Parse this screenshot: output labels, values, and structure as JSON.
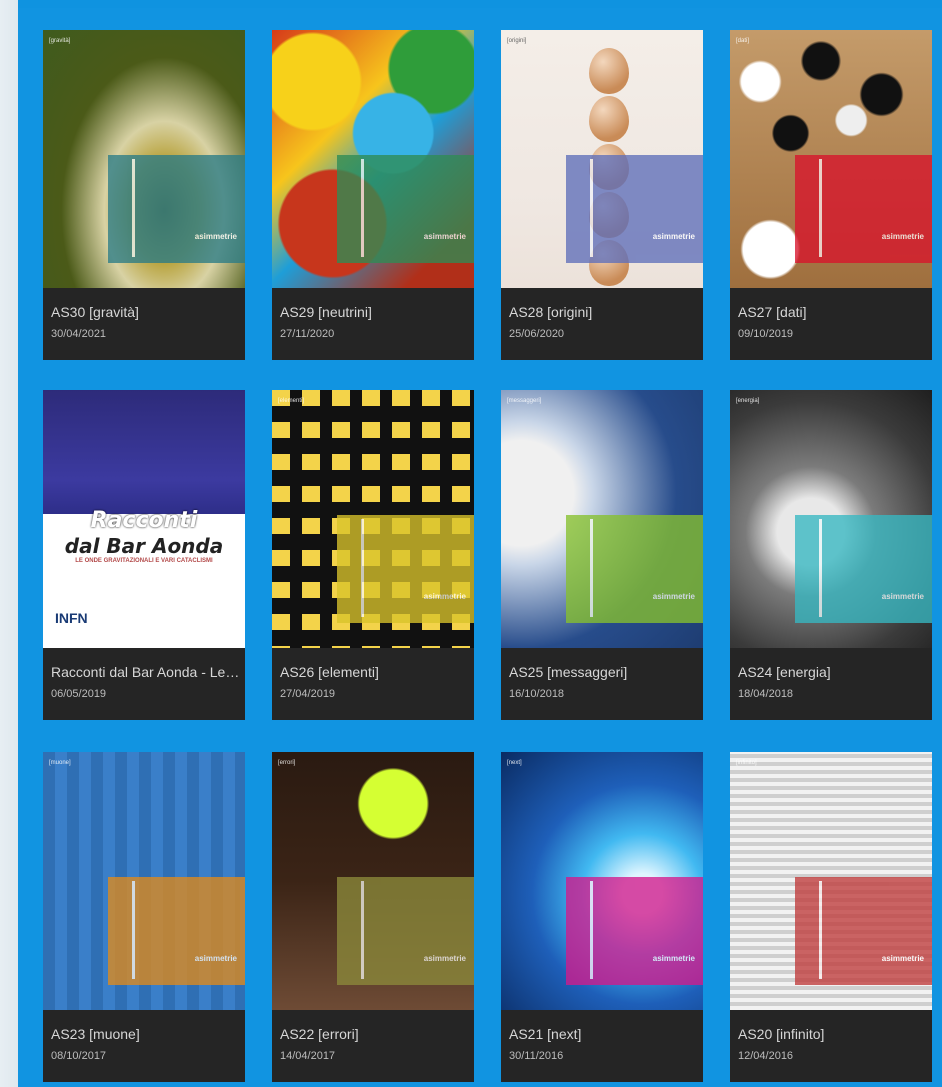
{
  "page": {
    "brand": "asimmetrie",
    "cards": [
      {
        "title": "AS30 [gravità]",
        "date": "30/04/2021",
        "tag": "[gravità]",
        "panel_color": "#2b7c86"
      },
      {
        "title": "AS29 [neutrini]",
        "date": "27/11/2020",
        "tag": "",
        "panel_color": "#2f8c55"
      },
      {
        "title": "AS28 [origini]",
        "date": "25/06/2020",
        "tag": "[origini]",
        "panel_color": "#5f6fba"
      },
      {
        "title": "AS27 [dati]",
        "date": "09/10/2019",
        "tag": "[dati]",
        "panel_color": "#d8142c"
      },
      {
        "title": "Racconti dal Bar Aonda - Le…",
        "date": "06/05/2019",
        "tag": "",
        "panel_color": ""
      },
      {
        "title": "AS26 [elementi]",
        "date": "27/04/2019",
        "tag": "[elementi]",
        "panel_color": "#d9c42b"
      },
      {
        "title": "AS25 [messaggeri]",
        "date": "16/10/2018",
        "tag": "[messaggeri]",
        "panel_color": "#87c12e"
      },
      {
        "title": "AS24 [energia]",
        "date": "18/04/2018",
        "tag": "[energia]",
        "panel_color": "#37b8c2"
      },
      {
        "title": "AS23 [muone]",
        "date": "08/10/2017",
        "tag": "[muone]",
        "panel_color": "#e08a1b"
      },
      {
        "title": "AS22 [errori]",
        "date": "14/04/2017",
        "tag": "[errori]",
        "panel_color": "#8c8a3b"
      },
      {
        "title": "AS21 [next]",
        "date": "30/11/2016",
        "tag": "[next]",
        "panel_color": "#d31a8c"
      },
      {
        "title": "AS20 [infinito]",
        "date": "12/04/2016",
        "tag": "[infinito]",
        "panel_color": "#c03b3b"
      }
    ],
    "racconti": {
      "title_line1": "Racconti",
      "title_line2": "dal Bar Aonda",
      "subtitle": "LE ONDE GRAVITAZIONALI E VARI CATACLISMI",
      "logo": "INFN"
    }
  }
}
